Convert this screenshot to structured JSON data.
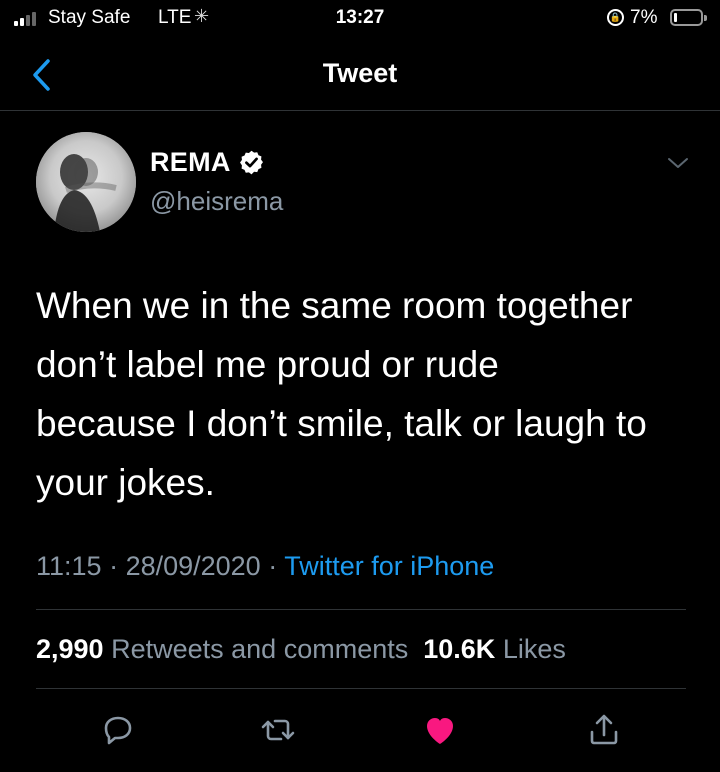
{
  "status_bar": {
    "carrier": "Stay Safe",
    "network": "LTE",
    "time": "13:27",
    "battery": "7%",
    "battery_level": 0.07
  },
  "header": {
    "title": "Tweet",
    "back_icon": "chevron-left-icon"
  },
  "tweet": {
    "author_name": "REMA",
    "handle": "@heisrema",
    "verified": true,
    "text_lines": [
      "When we in the same room together",
      "don’t label me proud or rude",
      "because I don’t smile, talk or laugh to",
      "your jokes."
    ],
    "time": "11:15",
    "separator": " · ",
    "date": "28/09/2020",
    "source": "Twitter for iPhone"
  },
  "stats": {
    "retweets_count": "2,990",
    "retweets_label": "Retweets and comments",
    "likes_count": "10.6K",
    "likes_label": "Likes"
  },
  "actions": [
    "reply-icon",
    "retweet-icon",
    "like-icon",
    "share-icon"
  ],
  "colors": {
    "background": "#000000",
    "accent": "#1d9bf0",
    "secondary_text": "#8b98a5",
    "like": "#f91880",
    "divider": "#2f3336"
  }
}
